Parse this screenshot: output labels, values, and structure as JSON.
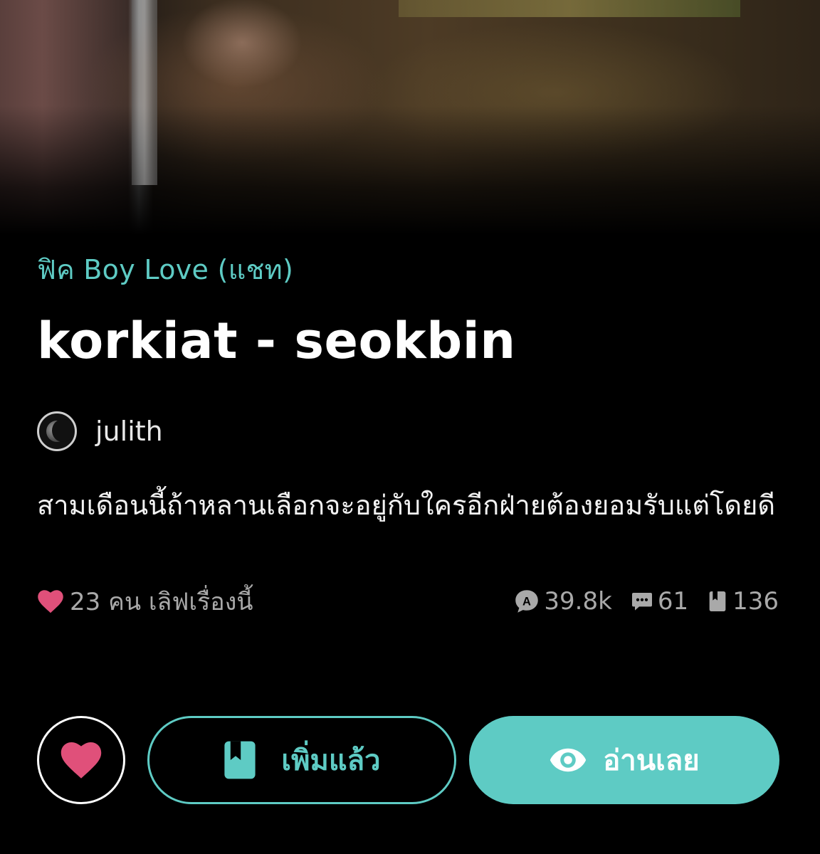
{
  "cover": {
    "alt": ""
  },
  "story": {
    "category": "ฟิค Boy Love (แชท)",
    "title": "korkiat - seokbin",
    "author": "julith",
    "synopsis": "สามเดือนนี้ถ้าหลานเลือกจะอยู่กับใครอีกฝ่ายต้องยอมรับแต่โดยดี"
  },
  "stats": {
    "lovers_text": "23 คน เลิฟเรื่องนี้",
    "views": "39.8k",
    "comments": "61",
    "bookmarks": "136"
  },
  "actions": {
    "added_label": "เพิ่มแล้ว",
    "read_label": "อ่านเลย"
  },
  "colors": {
    "accent": "#5ecbc4",
    "heart": "#e0507a",
    "background": "#000000"
  },
  "icons": {
    "heart": "heart-icon",
    "views": "views-icon",
    "comments": "comment-icon",
    "bookmarks": "bookmark-icon",
    "added": "bookmark-icon",
    "read": "eye-icon"
  }
}
